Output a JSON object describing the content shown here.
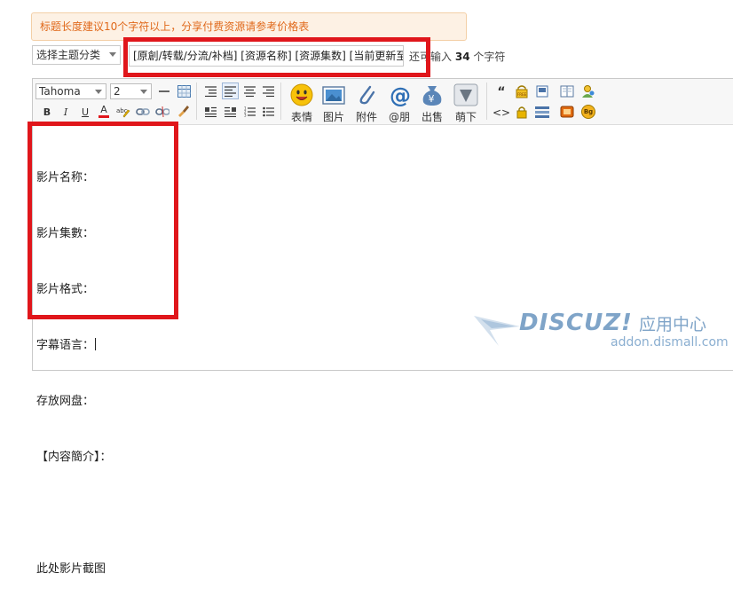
{
  "notice": {
    "text": "标题长度建议10个字符以上，分享付费资源请参考价格表"
  },
  "topic": {
    "select_value": "选择主题分类",
    "title_value": "[原創/转载/分流/补档] [资源名称] [资源集数] [当前更新至",
    "remain_prefix": "还可输入",
    "remain_count": "34",
    "remain_suffix": "个字符"
  },
  "toolbar": {
    "font_family": "Tahoma",
    "font_size": "2",
    "bold": "B",
    "italic": "I",
    "underline": "U",
    "font_color": "A",
    "quote_icon": "“",
    "code_icon": "<>",
    "bg_label": "Bg",
    "big_buttons": [
      {
        "label": "表情"
      },
      {
        "label": "图片"
      },
      {
        "label": "附件"
      },
      {
        "label": "@朋"
      },
      {
        "label": "出售"
      },
      {
        "label": "萌下"
      }
    ]
  },
  "editor": {
    "lines": [
      "影片名称：",
      "影片集數：",
      "影片格式：",
      "字幕语言：",
      "存放网盘：",
      "【内容簡介】：",
      "",
      "此处影片截图"
    ]
  },
  "watermark": {
    "logo": "DISCUZ!",
    "cn": "应用中心",
    "url": "addon.dismall.com"
  },
  "colors": {
    "notice_text": "#e0691b",
    "notice_bg": "#fdf1e4",
    "highlight_red": "#e0161b",
    "watermark": "#7fa4c8"
  }
}
